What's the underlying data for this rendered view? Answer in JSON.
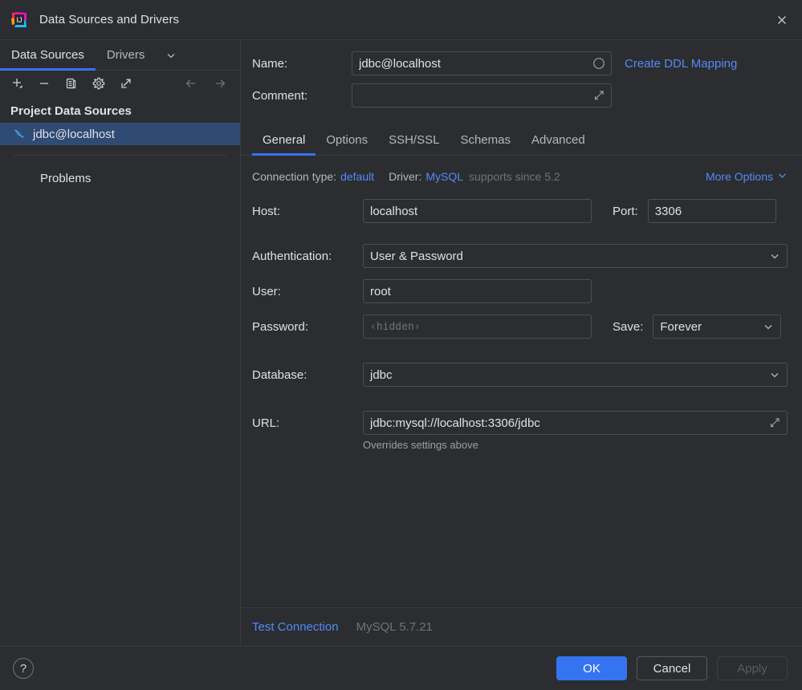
{
  "window": {
    "title": "Data Sources and Drivers",
    "app_icon": "intellij-idea-logo",
    "close_icon": "close-icon"
  },
  "left_panel": {
    "tabs": [
      {
        "label": "Data Sources",
        "active": true
      },
      {
        "label": "Drivers",
        "active": false
      }
    ],
    "tabs_overflow_icon": "chevron-down-icon",
    "toolbar": [
      {
        "name": "add-button",
        "icon": "plus-icon"
      },
      {
        "name": "remove-button",
        "icon": "minus-icon"
      },
      {
        "name": "duplicate-button",
        "icon": "copy-icon"
      },
      {
        "name": "settings-button",
        "icon": "gear-icon"
      },
      {
        "name": "open-external-button",
        "icon": "external-link-icon"
      }
    ],
    "nav": [
      {
        "name": "back-button",
        "icon": "arrow-left-icon"
      },
      {
        "name": "forward-button",
        "icon": "arrow-right-icon"
      }
    ],
    "tree": {
      "group_label": "Project Data Sources",
      "items": [
        {
          "label": "jdbc@localhost",
          "icon": "mysql-dolphin-icon",
          "selected": true
        }
      ],
      "problems_label": "Problems"
    }
  },
  "right_panel": {
    "name": {
      "label": "Name:",
      "value": "jdbc@localhost",
      "status_icon": "circle-icon"
    },
    "comment": {
      "label": "Comment:",
      "value": "",
      "expand_icon": "expand-arrow-icon"
    },
    "create_ddl_mapping_label": "Create DDL Mapping",
    "tabs": [
      {
        "label": "General",
        "active": true
      },
      {
        "label": "Options",
        "active": false
      },
      {
        "label": "SSH/SSL",
        "active": false
      },
      {
        "label": "Schemas",
        "active": false
      },
      {
        "label": "Advanced",
        "active": false
      }
    ],
    "meta": {
      "connection_type_label": "Connection type:",
      "connection_type_value": "default",
      "driver_label": "Driver:",
      "driver_value": "MySQL",
      "driver_note": "supports since 5.2",
      "more_options_label": "More Options",
      "more_options_icon": "chevron-down-icon"
    },
    "host": {
      "label": "Host:",
      "value": "localhost"
    },
    "port": {
      "label": "Port:",
      "value": "3306"
    },
    "authentication": {
      "label": "Authentication:",
      "value": "User & Password",
      "chevron_icon": "chevron-down-icon"
    },
    "user": {
      "label": "User:",
      "value": "root"
    },
    "password": {
      "label": "Password:",
      "value": "",
      "placeholder": "‹hidden›"
    },
    "save": {
      "label": "Save:",
      "value": "Forever",
      "chevron_icon": "chevron-down-icon"
    },
    "database": {
      "label": "Database:",
      "value": "jdbc",
      "chevron_icon": "chevron-down-icon"
    },
    "url": {
      "label": "URL:",
      "value": "jdbc:mysql://localhost:3306/jdbc",
      "expand_icon": "expand-arrow-icon",
      "hint": "Overrides settings above"
    },
    "footer": {
      "test_connection_label": "Test Connection",
      "server_version": "MySQL 5.7.21"
    }
  },
  "dialog_bottom": {
    "help_label": "?",
    "ok_label": "OK",
    "cancel_label": "Cancel",
    "apply_label": "Apply"
  },
  "colors": {
    "background": "#2b2d30",
    "accent_blue": "#3574f0",
    "link_blue": "#548af7",
    "selection_blue": "#2f4a73",
    "border": "#393b40",
    "field_border": "#4c4f55",
    "muted_text": "#6f737a"
  }
}
